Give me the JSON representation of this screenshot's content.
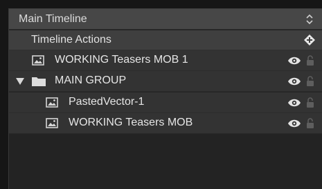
{
  "panel": {
    "title": "Main Timeline"
  },
  "actions": {
    "label": "Timeline Actions"
  },
  "layers": [
    {
      "label": "WORKING Teasers  MOB 1",
      "type": "image",
      "visible": true,
      "locked": false
    },
    {
      "label": "MAIN GROUP",
      "type": "group",
      "expanded": true,
      "visible": true,
      "locked": false
    },
    {
      "label": "PastedVector-1",
      "type": "image",
      "visible": true,
      "locked": false
    },
    {
      "label": "WORKING Teasers  MOB",
      "type": "image",
      "visible": true,
      "locked": false
    }
  ],
  "colors": {
    "header_bg": "#474747",
    "row_bg": "#333333",
    "text": "#e6e6e6",
    "icon": "#d8d8d8"
  }
}
